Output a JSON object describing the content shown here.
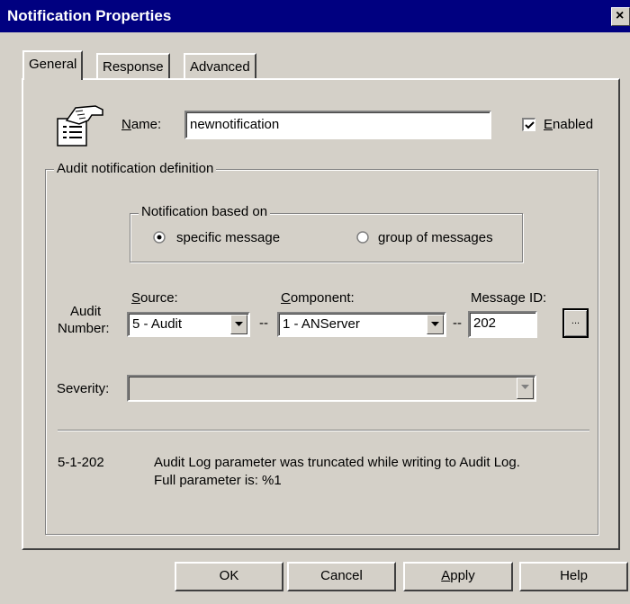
{
  "window": {
    "title": "Notification Properties",
    "close_glyph": "×"
  },
  "tabs": [
    {
      "label": "General",
      "active": true
    },
    {
      "label": "Response",
      "active": false
    },
    {
      "label": "Advanced",
      "active": false
    }
  ],
  "general": {
    "name_label_mnemonic": "N",
    "name_label_rest": "ame:",
    "name_value": "newnotification",
    "enabled_mnemonic": "E",
    "enabled_rest": "nabled",
    "enabled_checked": true,
    "icon": "notification-pointing-hand-icon"
  },
  "audit_group": {
    "legend": "Audit notification definition",
    "based_on": {
      "legend": "Notification based on",
      "options": [
        {
          "label": "specific message",
          "selected": true
        },
        {
          "label": "group of messages",
          "selected": false
        }
      ]
    },
    "audit_number_label_line1": "Audit",
    "audit_number_label_line2": "Number:",
    "source_label_mnemonic": "S",
    "source_label_rest": "ource:",
    "source_value": "5 - Audit",
    "component_label_mnemonic": "C",
    "component_label_rest": "omponent:",
    "component_value": "1 - ANServer",
    "message_id_label": "Message ID:",
    "message_id_value": "202",
    "separator": "--",
    "browse_glyph": "...",
    "severity_label": "Severity:",
    "severity_value": "",
    "message_code": "5-1-202",
    "message_text_line1": "Audit Log parameter was truncated while writing to Audit Log.",
    "message_text_line2": "Full parameter is: %1"
  },
  "buttons": {
    "ok": "OK",
    "cancel": "Cancel",
    "apply_mnemonic": "A",
    "apply_rest": "pply",
    "help": "Help"
  }
}
